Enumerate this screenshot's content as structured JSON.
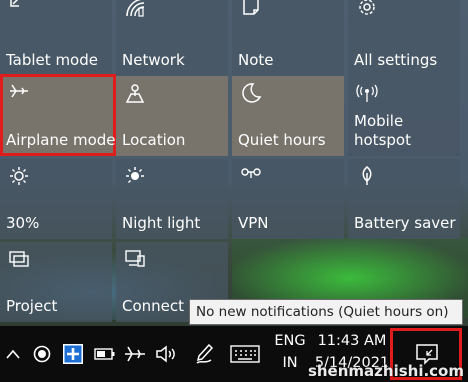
{
  "tiles": [
    {
      "label": "Tablet mode",
      "icon": "tablet-mode-icon"
    },
    {
      "label": "Network",
      "icon": "network-icon"
    },
    {
      "label": "Note",
      "icon": "note-icon"
    },
    {
      "label": "All settings",
      "icon": "settings-gear-icon"
    },
    {
      "label": "Airplane mode",
      "icon": "airplane-icon"
    },
    {
      "label": "Location",
      "icon": "location-icon"
    },
    {
      "label": "Quiet hours",
      "icon": "moon-icon"
    },
    {
      "label_line1": "Mobile",
      "label_line2": "hotspot",
      "icon": "hotspot-icon"
    },
    {
      "label": "30%",
      "icon": "brightness-icon"
    },
    {
      "label": "Night light",
      "icon": "night-light-icon"
    },
    {
      "label": "VPN",
      "icon": "vpn-icon"
    },
    {
      "label": "Battery saver",
      "icon": "battery-saver-icon"
    },
    {
      "label": "Project",
      "icon": "project-icon"
    },
    {
      "label": "Connect",
      "icon": "connect-icon"
    }
  ],
  "tooltip": {
    "text": "No new notifications (Quiet hours on)"
  },
  "taskbar": {
    "lang_line1": "ENG",
    "lang_line2": "IN",
    "time": "11:43 AM",
    "date": "5/14/2021",
    "icons": [
      "show-hidden-icons-chevron-icon",
      "record-icon",
      "app-plus-icon",
      "battery-icon",
      "airplane-icon",
      "volume-icon",
      "pen-icon",
      "keyboard-icon",
      "action-center-icon"
    ]
  },
  "watermark": "shenmazhishi.com",
  "colors": {
    "highlight_red": "#e11c1c",
    "tile_on": "#807868",
    "tile_off": "#485664",
    "taskbar": "#0c0c0c"
  }
}
